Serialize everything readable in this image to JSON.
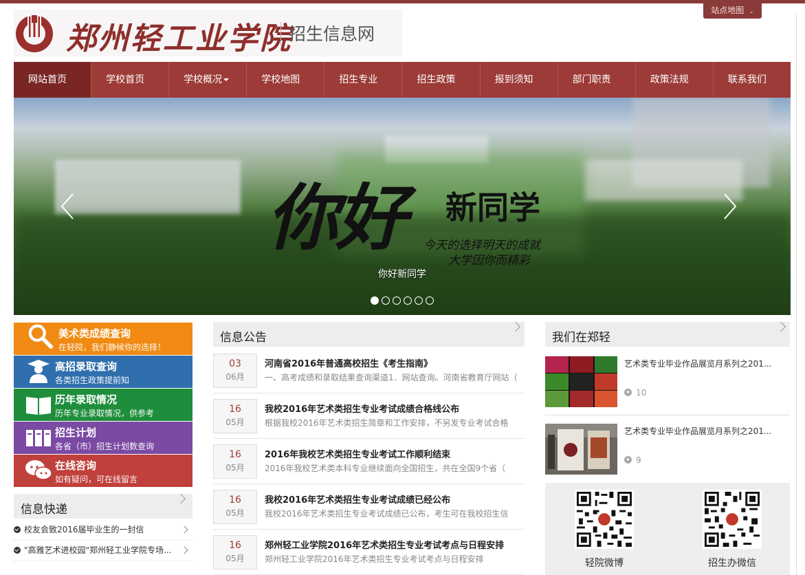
{
  "header": {
    "sitemap_label": "站点地图",
    "school_name": "郑州轻工业学院",
    "subtitle": "招生信息网",
    "brand_color": "#8a3a38"
  },
  "nav": {
    "items": [
      {
        "label": "网站首页",
        "active": true
      },
      {
        "label": "学校首页"
      },
      {
        "label": "学校概况",
        "dropdown": true
      },
      {
        "label": "学校地图"
      },
      {
        "label": "招生专业"
      },
      {
        "label": "招生政策"
      },
      {
        "label": "报到须知"
      },
      {
        "label": "部门职责"
      },
      {
        "label": "政策法规"
      },
      {
        "label": "联系我们"
      }
    ]
  },
  "banner": {
    "headline_big": "你好",
    "headline_mid": "新同学",
    "slogan_line1": "今天的选择明天的成就",
    "slogan_line2": "大学因你而精彩",
    "caption": "你好新同学",
    "slide_count": 6,
    "active_slide": 0
  },
  "quick_links": [
    {
      "title": "美术类成绩查询",
      "sub": "在轻院，我们静候你的选择！",
      "color": "#f08a12",
      "icon": "search-icon"
    },
    {
      "title": "高招录取查询",
      "sub": "各类招生政策提前知",
      "color": "#2f6fad",
      "icon": "student-icon"
    },
    {
      "title": "历年录取情况",
      "sub": "历年专业录取情况，供参考",
      "color": "#1f8e3c",
      "icon": "book-icon"
    },
    {
      "title": "招生计划",
      "sub": "各省（市）招生计划数查询",
      "color": "#7b4aa3",
      "icon": "files-icon"
    },
    {
      "title": "在线咨询",
      "sub": "如有疑问，可在线留言",
      "color": "#c0403b",
      "icon": "chat-icon"
    }
  ],
  "express": {
    "title": "信息快递",
    "items": [
      "校友会致2016届毕业生的一封信",
      "\"高雅艺术进校园\"郑州轻工业学院专场..."
    ]
  },
  "notices": {
    "title": "信息公告",
    "items": [
      {
        "day": "03",
        "month": "06月",
        "title": "河南省2016年普通高校招生《考生指南》",
        "desc": "一、高考成绩和录取结果查询渠道1．网站查询。河南省教育厅网站（"
      },
      {
        "day": "16",
        "month": "05月",
        "title": "我校2016年艺术类招生专业考试成绩合格线公布",
        "desc": "根据我校2016年艺术类招生简章和工作安排，不另发专业考试合格"
      },
      {
        "day": "16",
        "month": "05月",
        "title": "2016年我校艺术类招生专业考试工作顺利结束",
        "desc": "2016年我校艺术类本科专业继续面向全国招生，共在全国9个省（"
      },
      {
        "day": "16",
        "month": "05月",
        "title": "我校2016年艺术类招生专业考试成绩已经公布",
        "desc": "我校2016年艺术类招生专业考试成绩已公布，考生可在我校招生信"
      },
      {
        "day": "16",
        "month": "05月",
        "title": "郑州轻工业学院2016年艺术类招生专业考试考点与日程安排",
        "desc": "郑州轻工业学院2016年艺术类招生专业考试考点与日程安排"
      }
    ]
  },
  "campus": {
    "title": "我们在郑轻",
    "items": [
      {
        "title": "艺术类专业毕业作品展览月系列之201...",
        "views": "10"
      },
      {
        "title": "艺术类专业毕业作品展览月系列之201...",
        "views": "9"
      }
    ]
  },
  "qr": {
    "weibo_label": "轻院微博",
    "wechat_label": "招生办微信"
  }
}
